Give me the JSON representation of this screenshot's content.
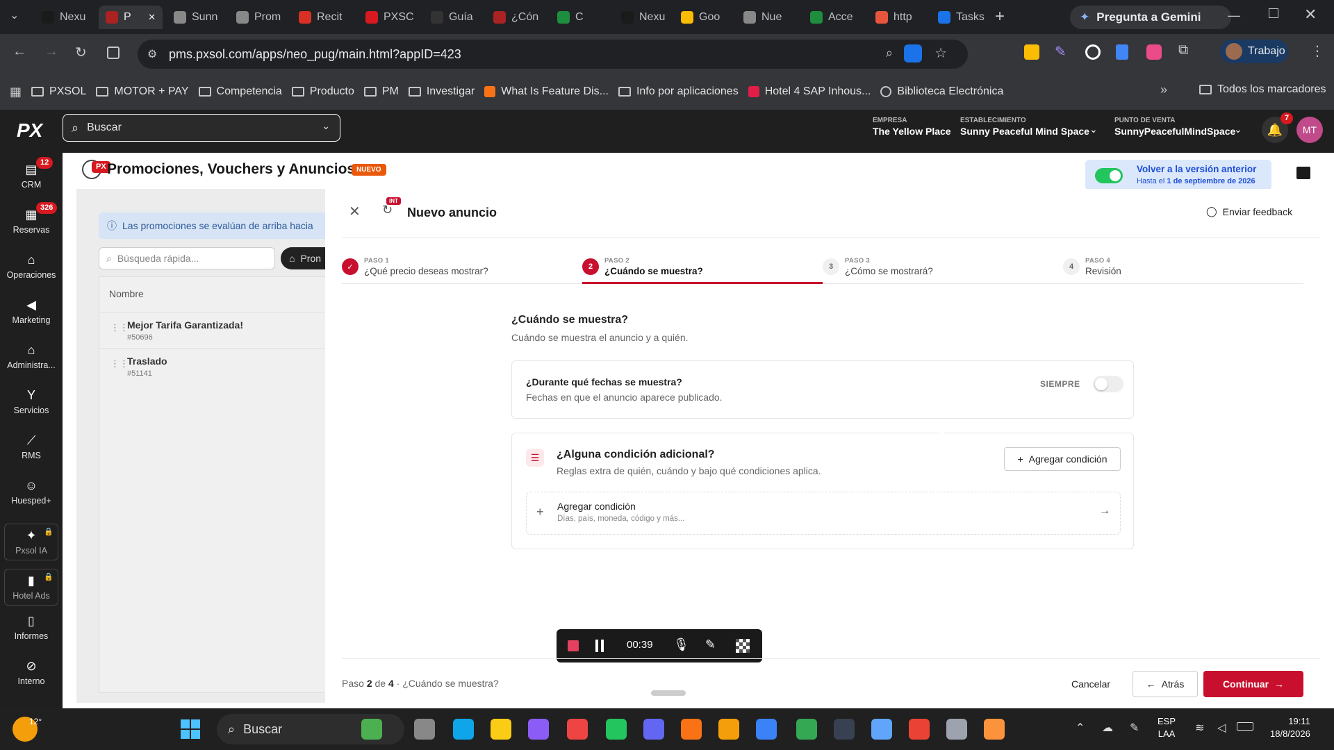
{
  "browser": {
    "tabs": [
      {
        "label": "Nexu",
        "color": "#1a1a1a"
      },
      {
        "label": "P",
        "color": "#a22"
      },
      {
        "label": "Sunn",
        "color": "#888"
      },
      {
        "label": "Prom",
        "color": "#888"
      },
      {
        "label": "Recit",
        "color": "#d93025"
      },
      {
        "label": "PXSC",
        "color": "#d71920"
      },
      {
        "label": "Guía",
        "color": "#333"
      },
      {
        "label": "¿Cón",
        "color": "#a22"
      },
      {
        "label": "C",
        "color": "#1e8e3e"
      },
      {
        "label": "Nexu",
        "color": "#1a1a1a"
      },
      {
        "label": "Goo",
        "color": "#fbbc04"
      },
      {
        "label": "Nue",
        "color": "#888"
      },
      {
        "label": "Acce",
        "color": "#1e8e3e"
      },
      {
        "label": "http",
        "color": "#e8553e"
      },
      {
        "label": "Tasks",
        "color": "#1a73e8"
      }
    ],
    "gemini_label": "Pregunta a Gemini",
    "url": "pms.pxsol.com/apps/neo_pug/main.html?appID=423",
    "profile_label": "Trabajo",
    "bookmarks": [
      "PXSOL",
      "MOTOR + PAY",
      "Competencia",
      "Producto",
      "PM",
      "Investigar",
      "What Is Feature Dis...",
      "Info por aplicaciones",
      "Hotel 4 SAP Inhous...",
      "Biblioteca Electrónica"
    ],
    "all_bookmarks": "Todos los marcadores"
  },
  "app": {
    "logo": "PX",
    "search_placeholder": "Buscar",
    "empresa_label": "EMPRESA",
    "empresa_value": "The Yellow Place",
    "establecimiento_label": "ESTABLECIMIENTO",
    "establecimiento_value": "Sunny Peaceful Mind Space",
    "pdv_label": "PUNTO DE VENTA",
    "pdv_value": "SunnyPeacefulMindSpace",
    "notif_count": "7",
    "avatar": "MT",
    "sidebar": [
      {
        "label": "CRM",
        "badge": "12",
        "icon": "chat-icon"
      },
      {
        "label": "Reservas",
        "badge": "326",
        "icon": "calendar-icon"
      },
      {
        "label": "Operaciones",
        "badge": "",
        "icon": "home-icon"
      },
      {
        "label": "Marketing",
        "badge": "",
        "icon": "megaphone-icon"
      },
      {
        "label": "Administra...",
        "badge": "",
        "icon": "bank-icon"
      },
      {
        "label": "Servicios",
        "badge": "",
        "icon": "glass-icon"
      },
      {
        "label": "RMS",
        "badge": "",
        "icon": "chart-icon"
      },
      {
        "label": "Huesped+",
        "badge": "",
        "icon": "users-icon"
      },
      {
        "label": "Pxsol IA",
        "badge": "",
        "icon": "sparkle-icon"
      },
      {
        "label": "Hotel Ads",
        "badge": "",
        "icon": "bar-icon"
      },
      {
        "label": "Informes",
        "badge": "",
        "icon": "doc-icon"
      },
      {
        "label": "Interno",
        "badge": "",
        "icon": "block-icon"
      }
    ],
    "page_title": "Promociones, Vouchers y Anuncios",
    "page_badge": "NUEVO",
    "legacy_title": "Volver a la versión anterior",
    "legacy_sub_prefix": "Hasta el",
    "legacy_sub_date": "1 de septiembre de 2026",
    "behind": {
      "info": "Las promociones se evalúan de arriba hacia",
      "search_placeholder": "Búsqueda rápida...",
      "filter_label": "Pron",
      "column": "Nombre",
      "rows": [
        {
          "name": "Mejor Tarifa Garantizada!",
          "id": "#50696"
        },
        {
          "name": "Traslado",
          "id": "#51141"
        }
      ]
    }
  },
  "modal": {
    "title": "Nuevo anuncio",
    "int_tag": "INT",
    "feedback": "Enviar feedback",
    "steps": [
      {
        "num": "1",
        "label": "PASO 1",
        "title": "¿Qué precio deseas mostrar?",
        "state": "done"
      },
      {
        "num": "2",
        "label": "PASO 2",
        "title": "¿Cuándo se muestra?",
        "state": "active"
      },
      {
        "num": "3",
        "label": "PASO 3",
        "title": "¿Cómo se mostrará?",
        "state": "todo"
      },
      {
        "num": "4",
        "label": "PASO 4",
        "title": "Revisión",
        "state": "todo"
      }
    ],
    "section_title": "¿Cuándo se muestra?",
    "section_sub": "Cuándo se muestra el anuncio y a quién.",
    "dates_title": "¿Durante qué fechas se muestra?",
    "dates_sub": "Fechas en que el anuncio aparece publicado.",
    "siempre": "SIEMPRE",
    "cond_title": "¿Alguna condición adicional?",
    "cond_sub": "Reglas extra de quién, cuándo y bajo qué condiciones aplica.",
    "add_cond_btn": "Agregar condición",
    "add_cond_row_title": "Agregar condición",
    "add_cond_row_sub": "Días, país, moneda, código y más...",
    "footer_prefix": "Paso",
    "footer_step": "2",
    "footer_of": "de",
    "footer_total": "4",
    "footer_sep": "·",
    "footer_step_name": "¿Cuándo se muestra?",
    "cancel": "Cancelar",
    "back": "Atrás",
    "continue": "Continuar"
  },
  "recorder": {
    "time": "00:39"
  },
  "taskbar": {
    "temp": "12°",
    "search": "Buscar",
    "lang1": "ESP",
    "lang2": "LAA",
    "time": "19:11",
    "date": "18/8/2026"
  },
  "colors": {
    "brand_red": "#c8102e",
    "toggle_green": "#22c55e"
  }
}
